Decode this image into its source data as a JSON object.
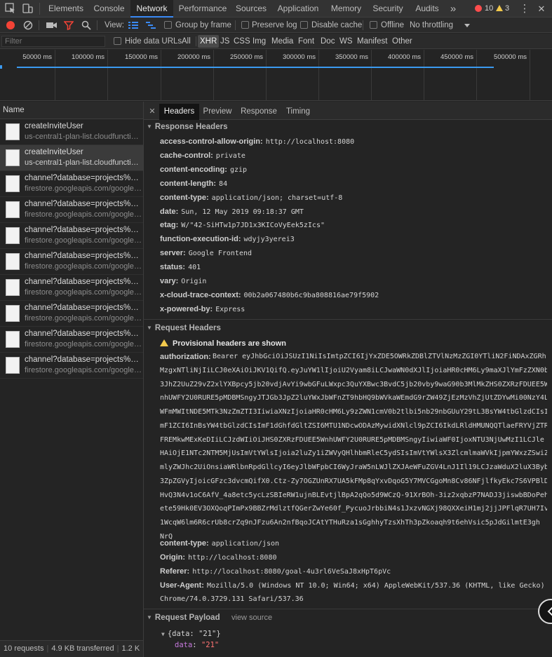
{
  "topbar": {
    "tabs": [
      "Elements",
      "Console",
      "Network",
      "Performance",
      "Sources",
      "Application",
      "Memory",
      "Security",
      "Audits"
    ],
    "active_tab": "Network",
    "more": "»",
    "errors": "10",
    "warnings": "3",
    "menu_glyph": "⋮",
    "close_glyph": "✕"
  },
  "toolbar": {
    "view_label": "View:",
    "group_by_frame": "Group by frame",
    "preserve_log": "Preserve log",
    "disable_cache": "Disable cache",
    "offline": "Offline",
    "throttling": "No throttling"
  },
  "filterbar": {
    "placeholder": "Filter",
    "hide_data_urls": "Hide data URLs",
    "types": [
      "All",
      "XHR",
      "JS",
      "CSS",
      "Img",
      "Media",
      "Font",
      "Doc",
      "WS",
      "Manifest",
      "Other"
    ],
    "selected_type": "XHR"
  },
  "overview": {
    "ticks": [
      "50000 ms",
      "100000 ms",
      "150000 ms",
      "200000 ms",
      "250000 ms",
      "300000 ms",
      "350000 ms",
      "400000 ms",
      "450000 ms",
      "500000 ms"
    ]
  },
  "requests": {
    "header": "Name",
    "items": [
      {
        "name": "createInviteUser",
        "domain": "us-central1-plan-list.cloudfunctions.net",
        "selected": false
      },
      {
        "name": "createInviteUser",
        "domain": "us-central1-plan-list.cloudfunctions.net",
        "selected": true
      },
      {
        "name": "channel?database=projects%2Fplan-list",
        "domain": "firestore.googleapis.com/google.firestore.v1",
        "selected": false
      },
      {
        "name": "channel?database=projects%2Fplan-list",
        "domain": "firestore.googleapis.com/google.firestore.v1",
        "selected": false
      },
      {
        "name": "channel?database=projects%2Fplan-list",
        "domain": "firestore.googleapis.com/google.firestore.v1",
        "selected": false
      },
      {
        "name": "channel?database=projects%2Fplan-list",
        "domain": "firestore.googleapis.com/google.firestore.v1",
        "selected": false
      },
      {
        "name": "channel?database=projects%2Fplan-list",
        "domain": "firestore.googleapis.com/google.firestore.v1",
        "selected": false
      },
      {
        "name": "channel?database=projects%2Fplan-list",
        "domain": "firestore.googleapis.com/google.firestore.v1",
        "selected": false
      },
      {
        "name": "channel?database=projects%2Fplan-list",
        "domain": "firestore.googleapis.com/google.firestore.v1",
        "selected": false
      },
      {
        "name": "channel?database=projects%2Fplan-list",
        "domain": "firestore.googleapis.com/google.firestore.v1",
        "selected": false
      }
    ]
  },
  "status": {
    "requests": "10 requests",
    "transferred": "4.9 KB transferred",
    "resources": "1.2 K"
  },
  "detail": {
    "close_glyph": "✕",
    "tabs": [
      "Headers",
      "Preview",
      "Response",
      "Timing"
    ],
    "active_tab": "Headers",
    "response_headers_title": "Response Headers",
    "response_headers": [
      {
        "k": "access-control-allow-origin:",
        "v": "http://localhost:8080"
      },
      {
        "k": "cache-control:",
        "v": "private"
      },
      {
        "k": "content-encoding:",
        "v": "gzip"
      },
      {
        "k": "content-length:",
        "v": "84"
      },
      {
        "k": "content-type:",
        "v": "application/json; charset=utf-8"
      },
      {
        "k": "date:",
        "v": "Sun, 12 May 2019 09:18:37 GMT"
      },
      {
        "k": "etag:",
        "v": "W/\"42-SiHTw1p7JD1x3KICoVyEek5zIcs\""
      },
      {
        "k": "function-execution-id:",
        "v": "wdyjy3yerei3"
      },
      {
        "k": "server:",
        "v": "Google Frontend"
      },
      {
        "k": "status:",
        "v": "401"
      },
      {
        "k": "vary:",
        "v": "Origin"
      },
      {
        "k": "x-cloud-trace-context:",
        "v": "00b2a067480b6c9ba808816ae79f5902"
      },
      {
        "k": "x-powered-by:",
        "v": "Express"
      }
    ],
    "request_headers_title": "Request Headers",
    "provisional_warning": "Provisional headers are shown",
    "authorization_key": "authorization:",
    "authorization_lines": [
      "Bearer eyJhbGciOiJSUzI1NiIsImtpZCI6IjYxZDE5OWRkZDBlZTVlNzMzZGI0YTliN2FiNDAxZGRh",
      "MzgxNTliNjIiLCJ0eXAiOiJKV1QifQ.eyJuYW1lIjoiU2Vyam8iLCJwaWN0dXJlIjoiaHR0cHM6Ly9maXJlYmFzZXN0b",
      "3JhZ2UuZ29vZ2xlYXBpcy5jb20vdjAvYi9wbGFuLWxpc3QuYXBwc3BvdC5jb20vby9waG90b3MlMkZHS0ZXRzFDUEE5W",
      "nhUWFY2U0RURE5pMDBMSngyJTJGb3JpZ2luYWxJbWFnZT9hbHQ9bWVkaWEmdG9rZW49ZjEzMzVhZjUtZDYwMi00NzY4L",
      "WFmMWItNDE5MTk3NzZmZTI3IiwiaXNzIjoiaHR0cHM6Ly9zZWN1cmV0b2tlbi5nb29nbGUuY29tL3BsYW4tbGlzdCIsI",
      "mF1ZCI6InBsYW4tbGlzdCIsImF1dGhfdGltZSI6MTU1NDcwODAzMywidXNlcl9pZCI6IkdLRldHMUNQQTlaeFRYVjZTR",
      "FREMkwMExKeDIiLCJzdWIiOiJHS0ZXRzFDUEE5WnhUWFY2U0RURE5pMDBMSngyIiwiaWF0IjoxNTU3NjUwMzI1LCJle",
      "HAiOjE1NTc2NTM5MjUsImVtYWlsIjoia2luZy1iZWVyQHlhbmRleC5ydSIsImVtYWlsX3ZlcmlmaWVkIjpmYWxzZSwiZ",
      "mlyZWJhc2UiOnsiaWRlbnRpdGllcyI6eyJlbWFpbCI6WyJraW5nLWJlZXJAeWFuZGV4LnJ1Il19LCJzaWduX2luX3Byb",
      "3ZpZGVyIjoicGFzc3dvcmQifX0.Ctz-Zy7OGZUnRX7UA5kFMp8qYxvDqoG5Y7MVCGgoMn8Cv86NFjlfkyEkc7S6VPBlD",
      "HvQ3N4v1oC6AfV_4a8etc5ycLzSBIeRW1ujnBLEvtjlBpA2qQo5d9WCzQ-91XrBOh-3iz2xqbzP7NADJ3jiswbBDoPeh",
      "ete59Hk0EV3OXQoqPImPx9BBZrMdlztfQGerZwYe60f_PycuoJrbbiN4s1JxzvNGXj98QXXeiH1mj2jjJPFlqR7UH7Iv",
      "1WcqW6lm6R6crUb8crZq9nJFzu6An2nfBqoJCAtYTHuRza1sGghhyTzsXhTh3pZkoaqh9t6ehVsic5pJdGilmtE3gh",
      "NrQ"
    ],
    "request_headers": [
      {
        "k": "content-type:",
        "v": "application/json"
      },
      {
        "k": "Origin:",
        "v": "http://localhost:8080"
      },
      {
        "k": "Referer:",
        "v": "http://localhost:8080/goal-4u3rl6VeSaJ8xHpT6pVc"
      },
      {
        "k": "User-Agent:",
        "v": "Mozilla/5.0 (Windows NT 10.0; Win64; x64) AppleWebKit/537.36 (KHTML, like Gecko)"
      }
    ],
    "user_agent_cont": "Chrome/74.0.3729.131 Safari/537.36",
    "payload_title": "Request Payload",
    "view_source": "view source",
    "payload_summary": "{data: \"21\"}",
    "payload_key": "data",
    "payload_value": "\"21\""
  },
  "colors": {
    "accent": "#3a8af5",
    "error": "#ff4d4d",
    "warning": "#f2c94c",
    "record": "#f44336"
  }
}
